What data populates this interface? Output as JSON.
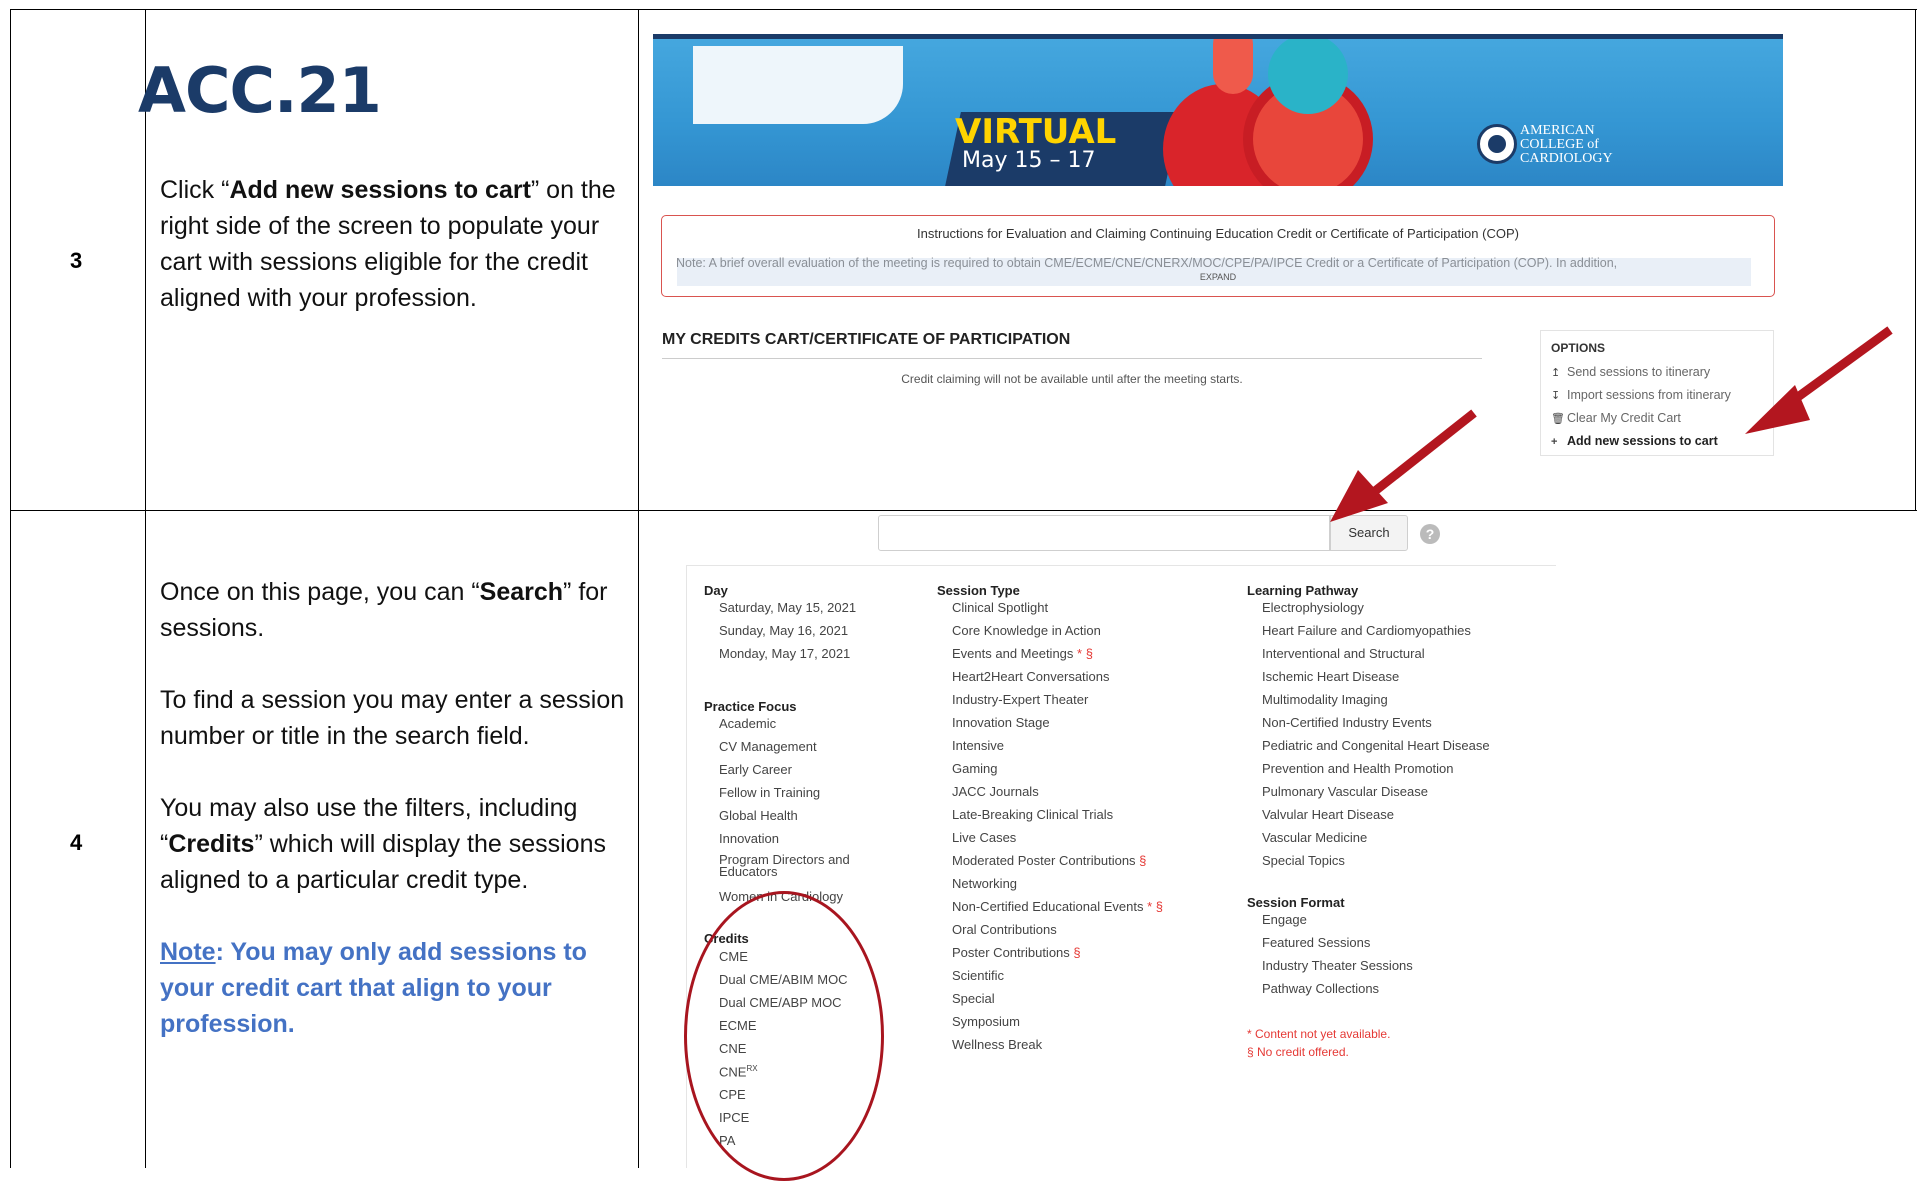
{
  "steps": [
    {
      "number": "3",
      "text_parts": [
        "Click “",
        "Add new sessions to cart",
        "” on the right side of the screen to populate your cart with sessions eligible for the credit aligned with your profession."
      ]
    },
    {
      "number": "4",
      "p1_parts": [
        "Once on this page, you can “",
        "Search",
        "” for sessions."
      ],
      "p2": "To find a session you may enter a session number or title in the search field.",
      "p3_parts": [
        "You may also use the filters, including “",
        "Credits",
        "” which will display the sessions aligned to a particular credit type."
      ],
      "note_label": "Note",
      "note_text": ": You may only add sessions to your credit cart that align to your profession."
    }
  ],
  "banner": {
    "title": "ACC.21",
    "virtual": "VIRTUAL",
    "dates": "May 15 – 17",
    "org_lines": [
      "AMERICAN",
      "COLLEGE of",
      "CARDIOLOGY"
    ]
  },
  "instructions": {
    "title": "Instructions for Evaluation and Claiming Continuing Education Credit or Certificate of Participation (COP)",
    "note": "Note: A brief overall evaluation of the meeting is required to obtain CME/ECME/CNE/CNERX/MOC/CPE/PA/IPCE Credit or a Certificate of Participation (COP). In addition,",
    "expand": "EXPAND"
  },
  "cart": {
    "title": "MY CREDITS CART/CERTIFICATE OF PARTICIPATION",
    "message": "Credit claiming will not be available until after the meeting starts."
  },
  "options": {
    "header": "OPTIONS",
    "items": [
      {
        "icon": "↥",
        "label": "Send sessions to itinerary"
      },
      {
        "icon": "↧",
        "label": "Import sessions from itinerary"
      },
      {
        "icon": "🗑",
        "label": "Clear My Credit Cart"
      },
      {
        "icon": "+",
        "label": "Add new sessions to cart"
      }
    ]
  },
  "search": {
    "placeholder": "",
    "button": "Search",
    "help": "?"
  },
  "filters": {
    "day": {
      "header": "Day",
      "items": [
        "Saturday, May 15, 2021",
        "Sunday, May 16, 2021",
        "Monday, May 17, 2021"
      ]
    },
    "practice": {
      "header": "Practice Focus",
      "items": [
        "Academic",
        "CV Management",
        "Early Career",
        "Fellow in Training",
        "Global Health",
        "Innovation",
        "Program Directors and Educators",
        "Women in Cardiology"
      ]
    },
    "credits": {
      "header": "Credits",
      "items": [
        "CME",
        "Dual CME/ABIM MOC",
        "Dual CME/ABP MOC",
        "ECME",
        "CNE",
        "CNE",
        "CPE",
        "IPCE",
        "PA"
      ],
      "cnerx_sup": "RX"
    },
    "session_type": {
      "header": "Session Type",
      "items": [
        "Clinical Spotlight",
        "Core Knowledge in Action",
        "Events and Meetings",
        "Heart2Heart Conversations",
        "Industry-Expert Theater",
        "Innovation Stage",
        "Intensive",
        "Gaming",
        "JACC Journals",
        "Late-Breaking Clinical Trials",
        "Live Cases",
        "Moderated Poster Contributions",
        "Networking",
        "Non-Certified Educational Events",
        "Oral Contributions",
        "Poster Contributions",
        "Scientific",
        "Special",
        "Symposium",
        "Wellness Break"
      ]
    },
    "marks": {
      "star_section": "* §",
      "section": "§"
    },
    "learning": {
      "header": "Learning Pathway",
      "items": [
        "Electrophysiology",
        "Heart Failure and Cardiomyopathies",
        "Interventional and Structural",
        "Ischemic Heart Disease",
        "Multimodality Imaging",
        "Non-Certified Industry Events",
        "Pediatric and Congenital Heart Disease",
        "Prevention and Health Promotion",
        "Pulmonary Vascular Disease",
        "Valvular Heart Disease",
        "Vascular Medicine",
        "Special Topics"
      ]
    },
    "format": {
      "header": "Session Format",
      "items": [
        "Engage",
        "Featured Sessions",
        "Industry Theater Sessions",
        "Pathway Collections"
      ]
    },
    "legend": [
      "* Content not yet available.",
      "§ No credit offered."
    ]
  },
  "colors": {
    "accent_red": "#a8151f",
    "note_blue": "#4472c4",
    "banner_blue": "#3c9ed8"
  }
}
